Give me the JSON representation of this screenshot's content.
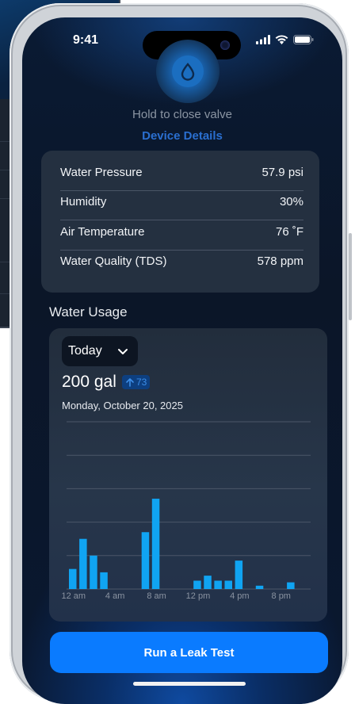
{
  "status_bar": {
    "time": "9:41"
  },
  "valve": {
    "hold_label": "Hold to close valve",
    "details_link": "Device Details"
  },
  "stats": [
    {
      "label": "Water Pressure",
      "value": "57.9 psi"
    },
    {
      "label": "Humidity",
      "value": "30%"
    },
    {
      "label": "Air Temperature",
      "value": "76 ˚F"
    },
    {
      "label": "Water Quality (TDS)",
      "value": "578 ppm"
    }
  ],
  "usage": {
    "title": "Water Usage",
    "period": "Today",
    "total": "200 gal",
    "delta": "73",
    "date": "Monday, October 20, 2025"
  },
  "chart_data": {
    "type": "bar",
    "x_tick_labels": [
      "12 am",
      "4 am",
      "8 am",
      "12 pm",
      "4 pm",
      "8 pm"
    ],
    "hours": [
      0,
      1,
      2,
      3,
      4,
      5,
      6,
      7,
      8,
      9,
      10,
      11,
      12,
      13,
      14,
      15,
      16,
      17,
      18,
      19,
      20,
      21,
      22,
      23
    ],
    "values": [
      6,
      15,
      10,
      5,
      0,
      0,
      0,
      17,
      27,
      0,
      0,
      0,
      2.5,
      4,
      2.5,
      2.5,
      8.5,
      0,
      1,
      0,
      0,
      2,
      0,
      0
    ],
    "ylim": [
      0,
      50
    ],
    "grid": true,
    "bar_color": "#10a4f2"
  },
  "actions": {
    "leak_test": "Run a Leak Test"
  },
  "colors": {
    "accent": "#0a7bff",
    "link": "#2a6fd0"
  }
}
